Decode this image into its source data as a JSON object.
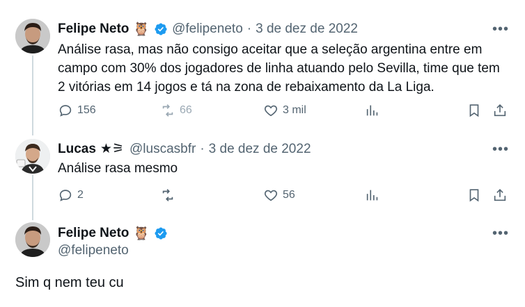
{
  "colors": {
    "text_primary": "#0f1419",
    "text_secondary": "#536471",
    "verified_blue": "#1d9bf0",
    "thread_line": "#cfd9de"
  },
  "tweet1": {
    "name": "Felipe Neto",
    "emoji": "🦉",
    "handle": "@felipeneto",
    "separator": "·",
    "date": "3 de dez de 2022",
    "text_lines": [
      "Análise rasa, mas não consigo aceitar que a seleção argentina entre em",
      "campo com 30% dos jogadores de linha atuando pelo Sevilla, time que tem",
      "2 vitórias em 14 jogos e tá na zona de rebaixamento da La Liga."
    ],
    "replies": "156",
    "retweets": "66",
    "likes": "3 mil",
    "more": "•••"
  },
  "tweet2": {
    "name": "Lucas",
    "emoji": "★⚞",
    "handle": "@luscasbfr",
    "separator": "·",
    "date": "3 de dez de 2022",
    "text": "Análise rasa mesmo",
    "replies": "2",
    "likes": "56",
    "more": "•••"
  },
  "tweet3": {
    "name": "Felipe Neto",
    "emoji": "🦉",
    "handle": "@felipeneto",
    "text": "Sim q nem teu cu",
    "more": "•••"
  },
  "icons": [
    "reply-icon",
    "retweet-icon",
    "like-icon",
    "views-icon",
    "bookmark-icon",
    "share-icon",
    "verified-badge-icon",
    "more-icon"
  ]
}
